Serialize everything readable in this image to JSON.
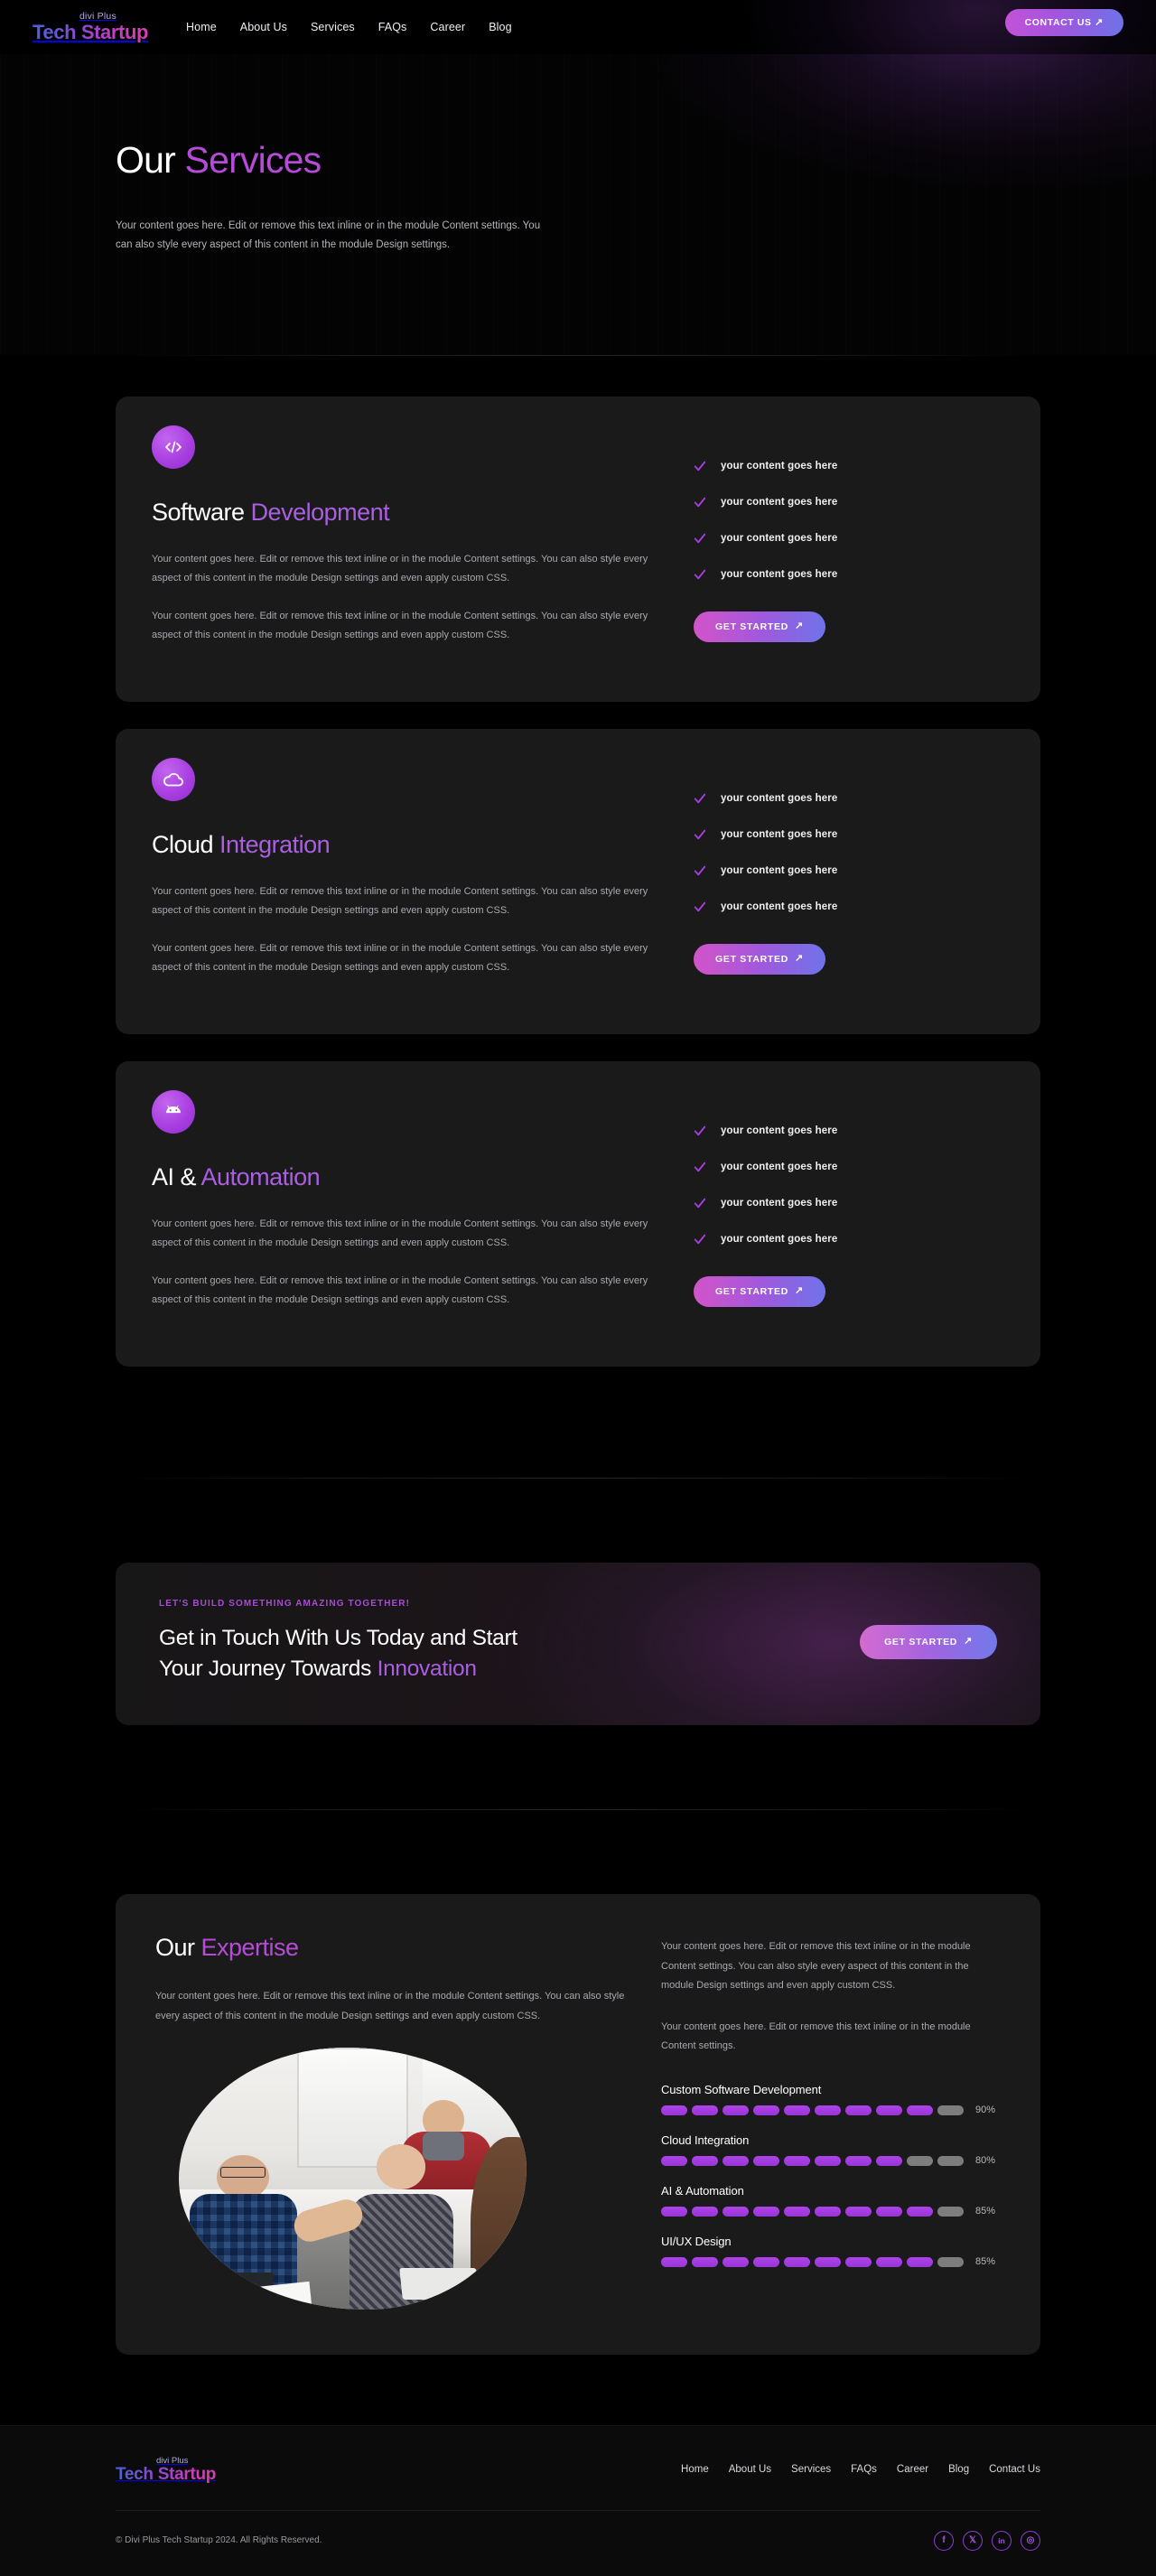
{
  "brand": {
    "sub": "divi Plus",
    "main": "Tech Startup"
  },
  "header": {
    "nav": [
      {
        "label": "Home"
      },
      {
        "label": "About Us"
      },
      {
        "label": "Services"
      },
      {
        "label": "FAQs"
      },
      {
        "label": "Career"
      },
      {
        "label": "Blog"
      }
    ],
    "contact_label": "CONTACT US",
    "arrow": "↗"
  },
  "hero": {
    "title_plain": "Our ",
    "title_accent": "Services",
    "description": "Your content goes here. Edit or remove this text inline or in the module Content settings. You can also style every aspect of this content in the module Design settings."
  },
  "services": [
    {
      "icon": "code-icon",
      "title_plain": "Software ",
      "title_accent": "Development",
      "paragraph1": "Your content goes here. Edit or remove this text inline or in the module Content settings. You can also style every aspect of this content in the module Design settings and even apply custom CSS.",
      "paragraph2": "Your content goes here. Edit or remove this text inline or in the module Content settings. You can also style every aspect of this content in the module Design settings and even apply custom CSS.",
      "checks": [
        "your content goes here",
        "your content goes here",
        "your content goes here",
        "your content goes here"
      ],
      "cta": "GET STARTED"
    },
    {
      "icon": "cloud-icon",
      "title_plain": "Cloud ",
      "title_accent": "Integration",
      "paragraph1": "Your content goes here. Edit or remove this text inline or in the module Content settings. You can also style every aspect of this content in the module Design settings and even apply custom CSS.",
      "paragraph2": "Your content goes here. Edit or remove this text inline or in the module Content settings. You can also style every aspect of this content in the module Design settings and even apply custom CSS.",
      "checks": [
        "your content goes here",
        "your content goes here",
        "your content goes here",
        "your content goes here"
      ],
      "cta": "GET STARTED"
    },
    {
      "icon": "android-robot-icon",
      "title_plain": "AI & ",
      "title_accent": "Automation",
      "paragraph1": "Your content goes here. Edit or remove this text inline or in the module Content settings. You can also style every aspect of this content in the module Design settings and even apply custom CSS.",
      "paragraph2": "Your content goes here. Edit or remove this text inline or in the module Content settings. You can also style every aspect of this content in the module Design settings and even apply custom CSS.",
      "checks": [
        "your content goes here",
        "your content goes here",
        "your content goes here",
        "your content goes here"
      ],
      "cta": "GET STARTED"
    }
  ],
  "cta": {
    "eyebrow": "LET'S BUILD SOMETHING AMAZING TOGETHER!",
    "line1": "Get in Touch With Us Today and Start",
    "line2_plain": "Your Journey Towards ",
    "line2_accent": "Innovation",
    "button": "GET STARTED"
  },
  "expertise": {
    "title_plain": "Our ",
    "title_accent": "Expertise",
    "left_paragraph": "Your content goes here. Edit or remove this text inline or in the module Content settings. You can also style every aspect of this content in the module Design settings and even apply custom CSS.",
    "right_paragraph1": "Your content goes here. Edit or remove this text inline or in the module Content settings. You can also style every aspect of this content in the module Design settings and even apply custom CSS.",
    "right_paragraph2": "Your content goes here. Edit or remove this text inline or in the module Content settings.",
    "image_alt": "office team meeting photo"
  },
  "chart_data": {
    "type": "bar",
    "title": "Our Expertise",
    "categories": [
      "Custom Software Development",
      "Cloud Integration",
      "AI & Automation",
      "UI/UX Design"
    ],
    "values": [
      90,
      80,
      85,
      85
    ],
    "labels": [
      "90%",
      "80%",
      "85%",
      "85%"
    ],
    "segments_total": 10,
    "segments_filled": [
      9,
      8,
      9,
      9
    ],
    "xlabel": "",
    "ylabel": "",
    "ylim": [
      0,
      100
    ],
    "grid": false,
    "legend": "none",
    "fill_color": "#a53fe0",
    "empty_color": "#7d7d7d"
  },
  "footer": {
    "nav": [
      {
        "label": "Home"
      },
      {
        "label": "About Us"
      },
      {
        "label": "Services"
      },
      {
        "label": "FAQs"
      },
      {
        "label": "Career"
      },
      {
        "label": "Blog"
      },
      {
        "label": "Contact Us"
      }
    ],
    "copyright": "© Divi Plus Tech Startup 2024. All Rights Reserved.",
    "socials": [
      {
        "name": "facebook-icon",
        "glyph": "f"
      },
      {
        "name": "x-twitter-icon",
        "glyph": "𝕏"
      },
      {
        "name": "linkedin-icon",
        "glyph": "in"
      },
      {
        "name": "instagram-icon",
        "glyph": "◎"
      }
    ]
  }
}
